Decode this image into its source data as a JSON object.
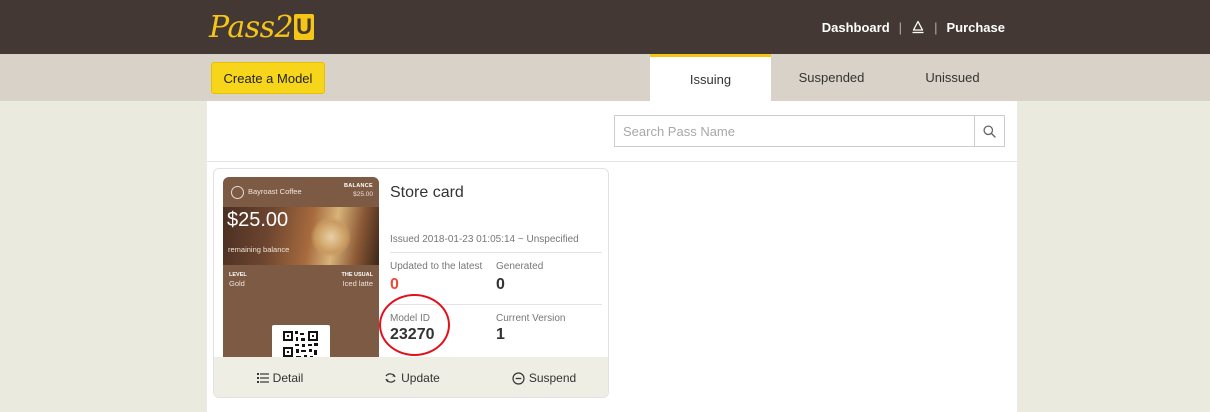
{
  "app": {
    "logo_text": "Pass2",
    "logo_badge": "U"
  },
  "topnav": {
    "dashboard": "Dashboard",
    "separator": "|",
    "purchase": "Purchase",
    "user_icon": "user-icon"
  },
  "toolbar": {
    "create_label": "Create a Model"
  },
  "tabs": [
    {
      "label": "Issuing",
      "active": true
    },
    {
      "label": "Suspended",
      "active": false
    },
    {
      "label": "Unissued",
      "active": false
    }
  ],
  "search": {
    "placeholder": "Search Pass Name",
    "icon": "search-icon"
  },
  "card": {
    "pass": {
      "brand": "Bayroast Coffee",
      "balance_label": "BALANCE",
      "balance_value": "$25.00",
      "amount": "$25.00",
      "remaining": "remaining balance",
      "level_label": "LEVEL",
      "level_value": "Gold",
      "usual_label": "THE USUAL",
      "usual_value": "Iced latte"
    },
    "title": "Store card",
    "issued": "Issued 2018-01-23 01:05:14 ~ Unspecified",
    "updated_label": "Updated to the latest",
    "updated_value": "0",
    "generated_label": "Generated",
    "generated_value": "0",
    "model_id_label": "Model ID",
    "model_id_value": "23270",
    "version_label": "Current Version",
    "version_value": "1",
    "actions": {
      "detail": "Detail",
      "update": "Update",
      "suspend": "Suspend"
    }
  },
  "colors": {
    "topbar": "#433833",
    "accent": "#f5c518",
    "subbar": "#d8d2c8",
    "highlight_red": "#e3101a"
  }
}
